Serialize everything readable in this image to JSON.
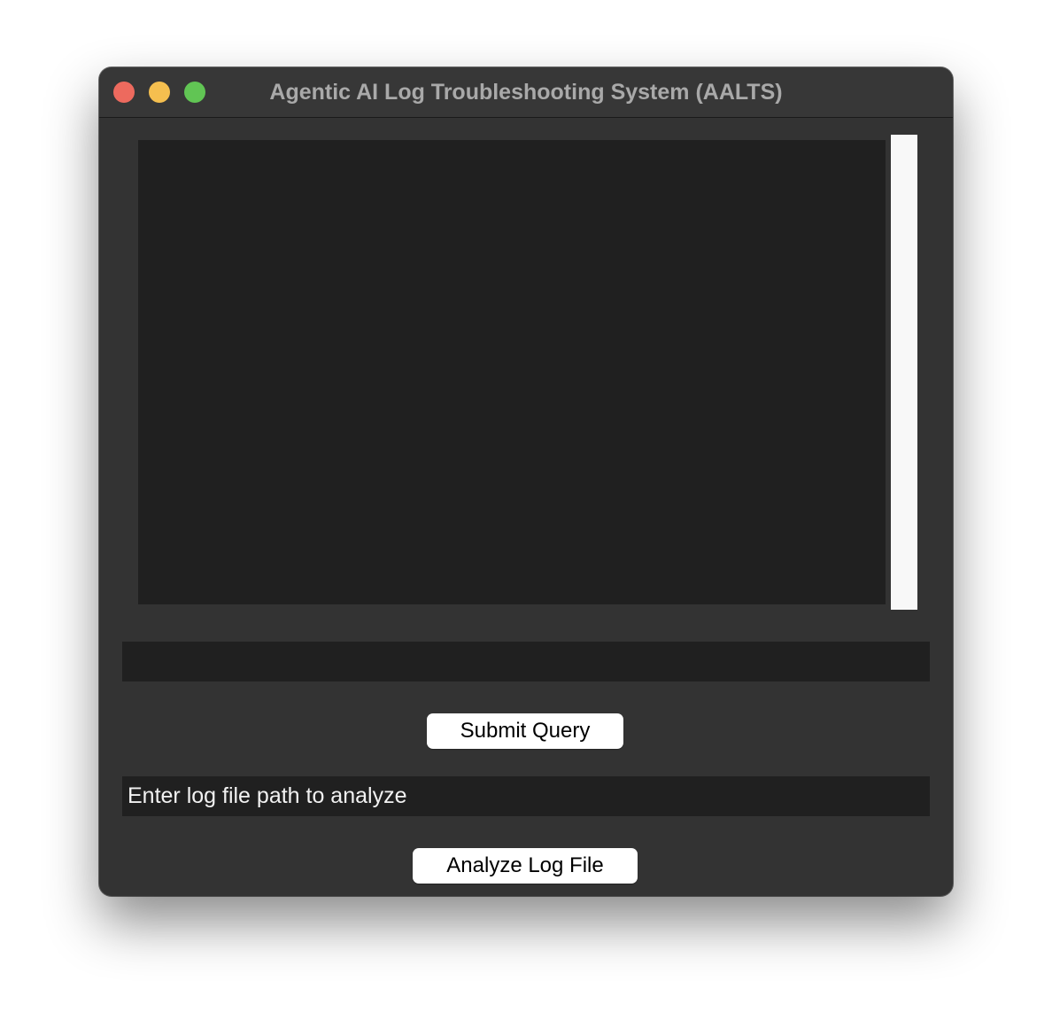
{
  "window": {
    "title": "Agentic AI Log Troubleshooting System (AALTS)"
  },
  "log_area": {
    "text": ""
  },
  "query": {
    "value": ""
  },
  "buttons": {
    "submit_label": "Submit Query",
    "analyze_label": "Analyze Log File"
  },
  "log_path": {
    "text": "Enter log file path to analyze"
  },
  "colors": {
    "window_bg": "#333333",
    "field_bg": "#202020",
    "close": "#ed6a5e",
    "minimize": "#f5bf4f",
    "zoom": "#61c554",
    "button_bg": "#ffffff"
  }
}
